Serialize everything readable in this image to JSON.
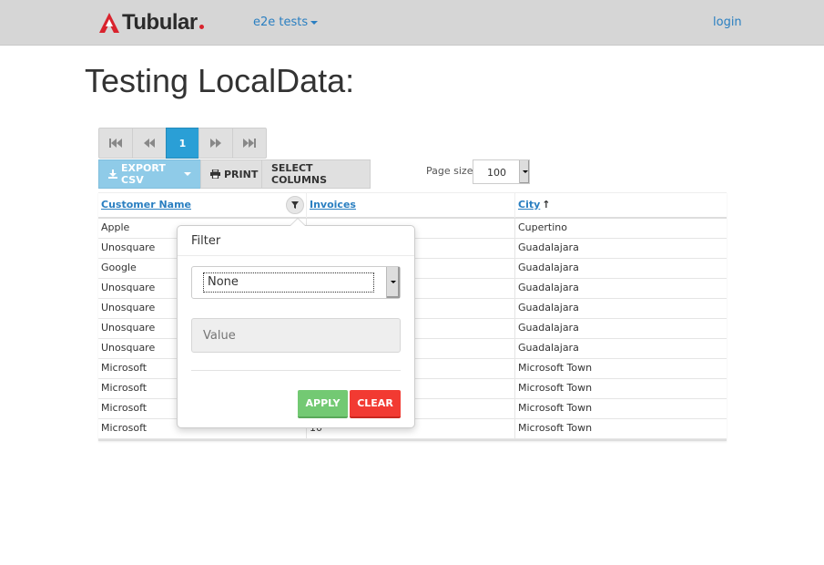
{
  "navbar": {
    "brand": "Tubular",
    "menu_label": "e2e tests",
    "login_label": "login"
  },
  "page_title": "Testing LocalData:",
  "pager": {
    "current_page": "1"
  },
  "toolbar": {
    "export_label": "EXPORT CSV",
    "print_label": "PRINT",
    "select_columns_label": "SELECT COLUMNS"
  },
  "page_size": {
    "label": "Page size:",
    "value": "100"
  },
  "table": {
    "columns": [
      "Customer Name",
      "Invoices",
      "City"
    ],
    "sort_indicator": "↑",
    "rows": [
      [
        "Apple",
        "",
        "Cupertino"
      ],
      [
        "Unosquare",
        "",
        "Guadalajara"
      ],
      [
        "Google",
        "",
        "Guadalajara"
      ],
      [
        "Unosquare",
        "",
        "Guadalajara"
      ],
      [
        "Unosquare",
        "",
        "Guadalajara"
      ],
      [
        "Unosquare",
        "",
        "Guadalajara"
      ],
      [
        "Unosquare",
        "",
        "Guadalajara"
      ],
      [
        "Microsoft",
        "",
        "Microsoft Town"
      ],
      [
        "Microsoft",
        "",
        "Microsoft Town"
      ],
      [
        "Microsoft",
        "",
        "Microsoft Town"
      ],
      [
        "Microsoft",
        "10",
        "Microsoft Town"
      ]
    ]
  },
  "filter_popover": {
    "title": "Filter",
    "operator_value": "None",
    "value_placeholder": "Value",
    "apply_label": "APPLY",
    "clear_label": "CLEAR"
  },
  "colors": {
    "navbar_bg": "#d6d6d6",
    "link": "#2a7fc1",
    "active_page": "#2a9fd6",
    "apply": "#73c973",
    "clear": "#f23a32",
    "brand_red": "#d9232d"
  }
}
